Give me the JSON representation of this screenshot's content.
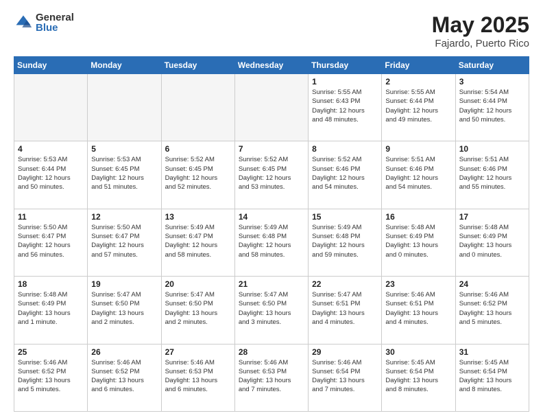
{
  "header": {
    "logo_general": "General",
    "logo_blue": "Blue",
    "title": "May 2025",
    "location": "Fajardo, Puerto Rico"
  },
  "days_of_week": [
    "Sunday",
    "Monday",
    "Tuesday",
    "Wednesday",
    "Thursday",
    "Friday",
    "Saturday"
  ],
  "weeks": [
    [
      {
        "day": "",
        "detail": "",
        "empty": true
      },
      {
        "day": "",
        "detail": "",
        "empty": true
      },
      {
        "day": "",
        "detail": "",
        "empty": true
      },
      {
        "day": "",
        "detail": "",
        "empty": true
      },
      {
        "day": "1",
        "detail": "Sunrise: 5:55 AM\nSunset: 6:43 PM\nDaylight: 12 hours\nand 48 minutes."
      },
      {
        "day": "2",
        "detail": "Sunrise: 5:55 AM\nSunset: 6:44 PM\nDaylight: 12 hours\nand 49 minutes."
      },
      {
        "day": "3",
        "detail": "Sunrise: 5:54 AM\nSunset: 6:44 PM\nDaylight: 12 hours\nand 50 minutes."
      }
    ],
    [
      {
        "day": "4",
        "detail": "Sunrise: 5:53 AM\nSunset: 6:44 PM\nDaylight: 12 hours\nand 50 minutes."
      },
      {
        "day": "5",
        "detail": "Sunrise: 5:53 AM\nSunset: 6:45 PM\nDaylight: 12 hours\nand 51 minutes."
      },
      {
        "day": "6",
        "detail": "Sunrise: 5:52 AM\nSunset: 6:45 PM\nDaylight: 12 hours\nand 52 minutes."
      },
      {
        "day": "7",
        "detail": "Sunrise: 5:52 AM\nSunset: 6:45 PM\nDaylight: 12 hours\nand 53 minutes."
      },
      {
        "day": "8",
        "detail": "Sunrise: 5:52 AM\nSunset: 6:46 PM\nDaylight: 12 hours\nand 54 minutes."
      },
      {
        "day": "9",
        "detail": "Sunrise: 5:51 AM\nSunset: 6:46 PM\nDaylight: 12 hours\nand 54 minutes."
      },
      {
        "day": "10",
        "detail": "Sunrise: 5:51 AM\nSunset: 6:46 PM\nDaylight: 12 hours\nand 55 minutes."
      }
    ],
    [
      {
        "day": "11",
        "detail": "Sunrise: 5:50 AM\nSunset: 6:47 PM\nDaylight: 12 hours\nand 56 minutes."
      },
      {
        "day": "12",
        "detail": "Sunrise: 5:50 AM\nSunset: 6:47 PM\nDaylight: 12 hours\nand 57 minutes."
      },
      {
        "day": "13",
        "detail": "Sunrise: 5:49 AM\nSunset: 6:47 PM\nDaylight: 12 hours\nand 58 minutes."
      },
      {
        "day": "14",
        "detail": "Sunrise: 5:49 AM\nSunset: 6:48 PM\nDaylight: 12 hours\nand 58 minutes."
      },
      {
        "day": "15",
        "detail": "Sunrise: 5:49 AM\nSunset: 6:48 PM\nDaylight: 12 hours\nand 59 minutes."
      },
      {
        "day": "16",
        "detail": "Sunrise: 5:48 AM\nSunset: 6:49 PM\nDaylight: 13 hours\nand 0 minutes."
      },
      {
        "day": "17",
        "detail": "Sunrise: 5:48 AM\nSunset: 6:49 PM\nDaylight: 13 hours\nand 0 minutes."
      }
    ],
    [
      {
        "day": "18",
        "detail": "Sunrise: 5:48 AM\nSunset: 6:49 PM\nDaylight: 13 hours\nand 1 minute."
      },
      {
        "day": "19",
        "detail": "Sunrise: 5:47 AM\nSunset: 6:50 PM\nDaylight: 13 hours\nand 2 minutes."
      },
      {
        "day": "20",
        "detail": "Sunrise: 5:47 AM\nSunset: 6:50 PM\nDaylight: 13 hours\nand 2 minutes."
      },
      {
        "day": "21",
        "detail": "Sunrise: 5:47 AM\nSunset: 6:50 PM\nDaylight: 13 hours\nand 3 minutes."
      },
      {
        "day": "22",
        "detail": "Sunrise: 5:47 AM\nSunset: 6:51 PM\nDaylight: 13 hours\nand 4 minutes."
      },
      {
        "day": "23",
        "detail": "Sunrise: 5:46 AM\nSunset: 6:51 PM\nDaylight: 13 hours\nand 4 minutes."
      },
      {
        "day": "24",
        "detail": "Sunrise: 5:46 AM\nSunset: 6:52 PM\nDaylight: 13 hours\nand 5 minutes."
      }
    ],
    [
      {
        "day": "25",
        "detail": "Sunrise: 5:46 AM\nSunset: 6:52 PM\nDaylight: 13 hours\nand 5 minutes."
      },
      {
        "day": "26",
        "detail": "Sunrise: 5:46 AM\nSunset: 6:52 PM\nDaylight: 13 hours\nand 6 minutes."
      },
      {
        "day": "27",
        "detail": "Sunrise: 5:46 AM\nSunset: 6:53 PM\nDaylight: 13 hours\nand 6 minutes."
      },
      {
        "day": "28",
        "detail": "Sunrise: 5:46 AM\nSunset: 6:53 PM\nDaylight: 13 hours\nand 7 minutes."
      },
      {
        "day": "29",
        "detail": "Sunrise: 5:46 AM\nSunset: 6:54 PM\nDaylight: 13 hours\nand 7 minutes."
      },
      {
        "day": "30",
        "detail": "Sunrise: 5:45 AM\nSunset: 6:54 PM\nDaylight: 13 hours\nand 8 minutes."
      },
      {
        "day": "31",
        "detail": "Sunrise: 5:45 AM\nSunset: 6:54 PM\nDaylight: 13 hours\nand 8 minutes."
      }
    ]
  ]
}
